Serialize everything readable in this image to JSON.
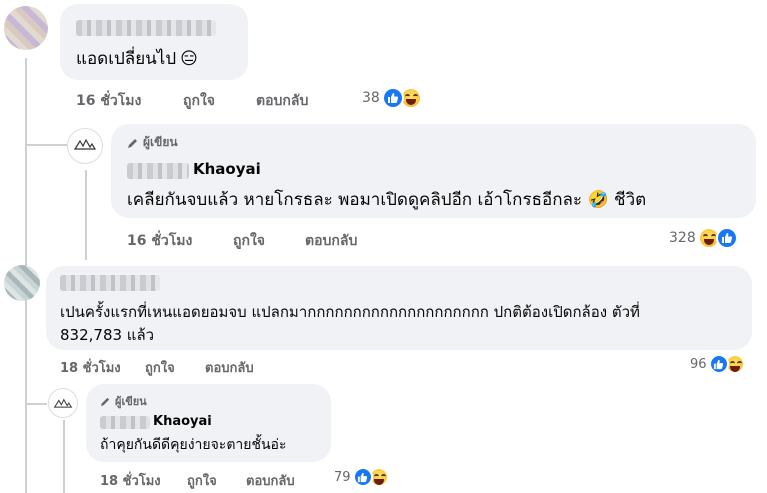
{
  "comments": [
    {
      "text": "แอดเปลี่ยนไป",
      "emoji": "😑",
      "time": "16 ชั่วโมง",
      "like": "ถูกใจ",
      "reply": "ตอบกลับ",
      "reactions": "38"
    },
    {
      "badge": "ผู้เขียน",
      "author": "Khaoyai",
      "text": "เคลียกันจบแล้ว หายโกรธละ พอมาเปิดดูคลิปอีก เอ้าโกรธอีกละ",
      "emoji": "🤣",
      "text_end": "ชีวิต",
      "time": "16 ชั่วโมง",
      "like": "ถูกใจ",
      "reply": "ตอบกลับ",
      "reactions": "328"
    },
    {
      "text_line1": "เปนครั้งแรกที่เหนแอดยอมจบ แปลกมากกกกกกกกกกกกกกกกกกกก ปกติต้องเปิดกล้อง ตัวที่",
      "text_line2": "832,783 แล้ว",
      "time": "18 ชั่วโมง",
      "like": "ถูกใจ",
      "reply": "ตอบกลับ",
      "reactions": "96"
    },
    {
      "badge": "ผู้เขียน",
      "author": "Khaoyai",
      "text": "ถ้าคุยกันดีดีคุยง่ายจะตายชั้นอ่ะ",
      "time": "18 ชั่วโมง",
      "like": "ถูกใจ",
      "reply": "ตอบกลับ",
      "reactions": "79"
    }
  ],
  "colors": {
    "bubble": "#f0f2f5",
    "meta": "#65676b",
    "like_blue": "#1877f2",
    "thread_line": "#ced0d4"
  },
  "icons": [
    "pencil-icon",
    "like-reaction-icon",
    "haha-reaction-icon",
    "page-logo"
  ]
}
